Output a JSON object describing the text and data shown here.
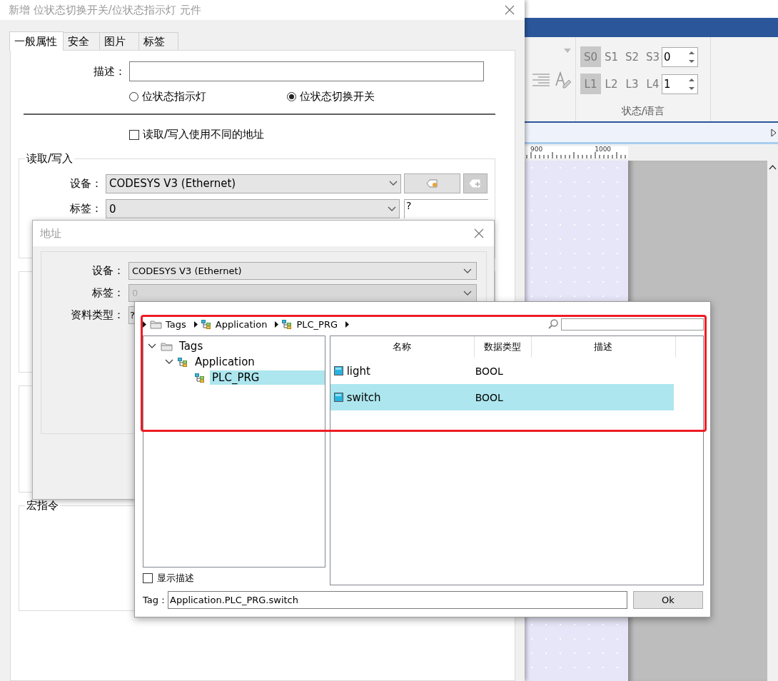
{
  "background_app": {
    "ribbon": {
      "state_buttons": [
        {
          "label": "S0",
          "selected": true
        },
        {
          "label": "S1",
          "selected": false
        },
        {
          "label": "S2",
          "selected": false
        },
        {
          "label": "S3",
          "selected": false
        }
      ],
      "state_value": "0",
      "language_buttons": [
        {
          "label": "L1",
          "selected": true
        },
        {
          "label": "L2",
          "selected": false
        },
        {
          "label": "L3",
          "selected": false
        },
        {
          "label": "L4",
          "selected": false
        }
      ],
      "language_value": "1",
      "group_label": "状态/语言"
    },
    "ruler": {
      "labels": [
        "900",
        "1000"
      ]
    }
  },
  "element_dialog": {
    "title": "新增 位状态切换开关/位状态指示灯 元件",
    "tabs": [
      {
        "label": "一般属性",
        "selected": true
      },
      {
        "label": "安全",
        "selected": false
      },
      {
        "label": "图片",
        "selected": false
      },
      {
        "label": "标签",
        "selected": false
      }
    ],
    "description_label": "描述：",
    "mode_options": [
      {
        "label": "位状态指示灯",
        "selected": false
      },
      {
        "label": "位状态切换开关",
        "selected": true
      }
    ],
    "separate_address": {
      "label": "读取/写入使用不同的地址",
      "checked": false
    },
    "read_write": {
      "title": "读取/写入",
      "device_label": "设备：",
      "device": "CODESYS V3 (Ethernet)",
      "tag_label": "标签：",
      "tag": "0",
      "tag_extra": "?"
    },
    "macro_group": {
      "title": "宏指令"
    }
  },
  "address_dialog": {
    "title": "地址",
    "device_label": "设备：",
    "device": "CODESYS V3 (Ethernet)",
    "tag_label": "标签：",
    "tag": "0",
    "tag_disabled": true,
    "data_type_label": "资料类型：",
    "data_type": "?"
  },
  "tag_browser": {
    "breadcrumb": [
      {
        "label": "Tags",
        "kind": "folder"
      },
      {
        "label": "Application",
        "kind": "program"
      },
      {
        "label": "PLC_PRG",
        "kind": "program"
      }
    ],
    "tree": [
      {
        "label": "Tags",
        "kind": "folder",
        "expanded": true,
        "selected": false,
        "children": [
          {
            "label": "Application",
            "kind": "program",
            "expanded": true,
            "selected": false,
            "children": [
              {
                "label": "PLC_PRG",
                "kind": "program",
                "selected": true
              }
            ]
          }
        ]
      }
    ],
    "columns": [
      "名称",
      "数据类型",
      "描述"
    ],
    "rows": [
      {
        "name": "light",
        "type": "BOOL",
        "selected": false
      },
      {
        "name": "switch",
        "type": "BOOL",
        "selected": true
      }
    ],
    "show_description": {
      "label": "显示描述",
      "checked": false
    },
    "tag_label": "Tag :",
    "tag_value": "Application.PLC_PRG.switch",
    "ok": "Ok"
  }
}
